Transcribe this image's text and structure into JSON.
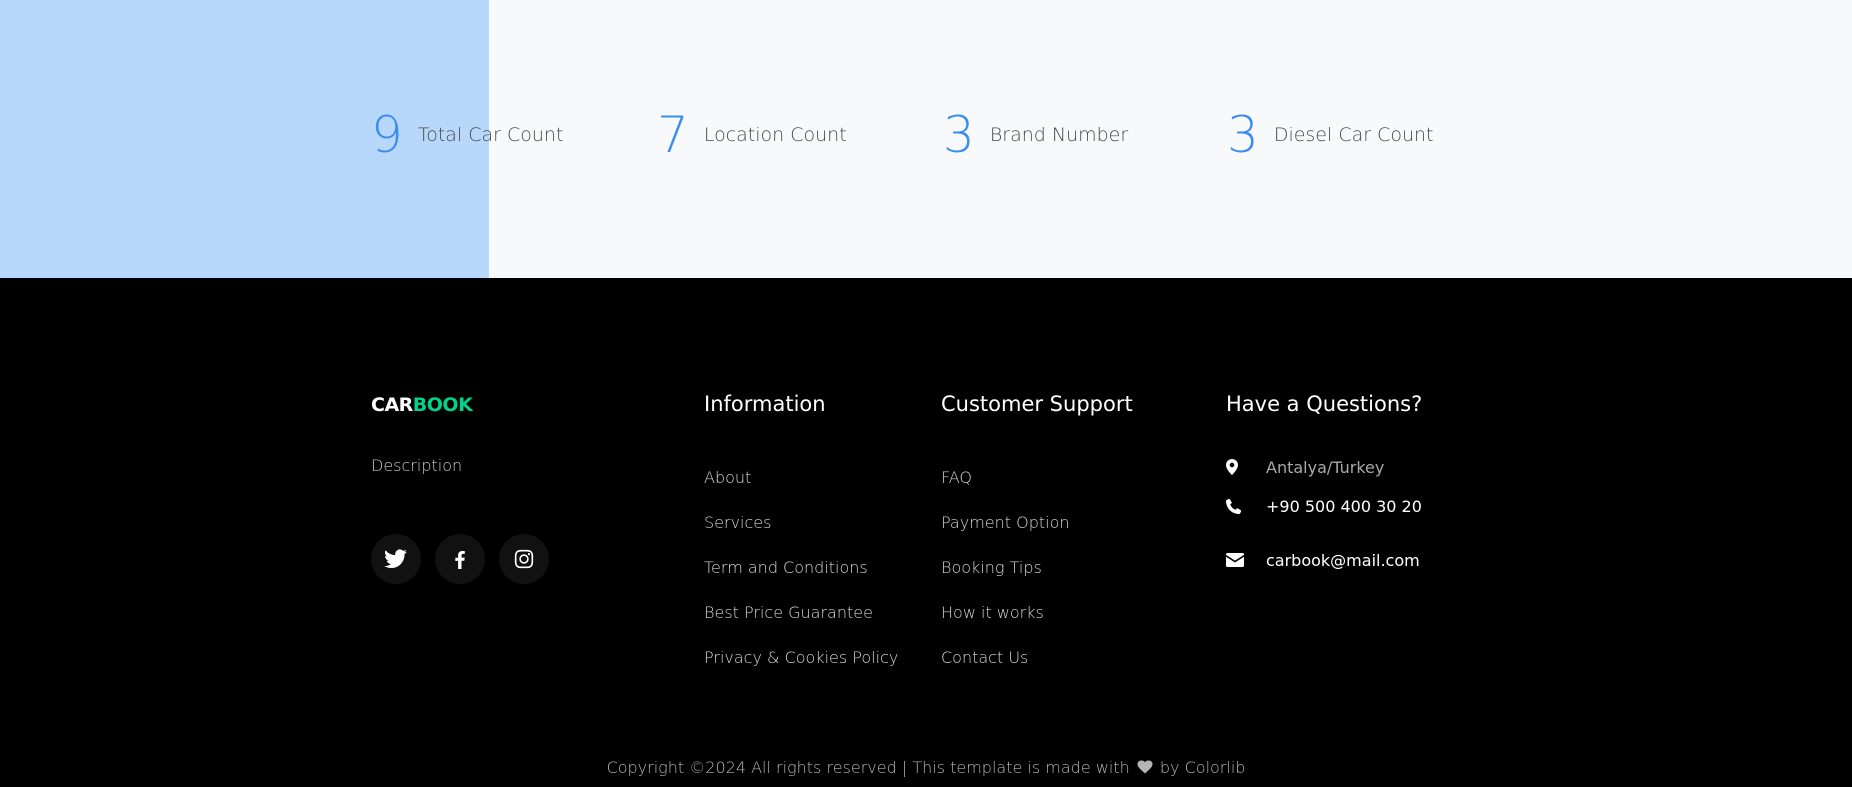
{
  "colors": {
    "accent": "#3a8df0",
    "counter_label": "#4a4a4a",
    "brand_green": "#01d28e",
    "footer_bg": "#000000",
    "counter_bg": "#f8f9fa",
    "counter_accent_panel": "#b8d8fb"
  },
  "counters": [
    {
      "number": "9",
      "label": "Total Car Count"
    },
    {
      "number": "7",
      "label": "Location Count"
    },
    {
      "number": "3",
      "label": "Brand Number"
    },
    {
      "number": "3",
      "label": "Diesel Car Count"
    }
  ],
  "footer": {
    "logo": {
      "part1": "CAR",
      "part2": "BOOK"
    },
    "description": "Description",
    "socials": [
      {
        "icon": "twitter-icon"
      },
      {
        "icon": "facebook-icon"
      },
      {
        "icon": "instagram-icon"
      }
    ],
    "information": {
      "title": "Information",
      "links": [
        "About",
        "Services",
        "Term and Conditions",
        "Best Price Guarantee",
        "Privacy & Cookies Policy"
      ]
    },
    "support": {
      "title": "Customer Support",
      "links": [
        "FAQ",
        "Payment Option",
        "Booking Tips",
        "How it works",
        "Contact Us"
      ]
    },
    "contact": {
      "title": "Have a Questions?",
      "address": "Antalya/Turkey",
      "phone": "+90 500 400 30 20",
      "email": "carbook@mail.com"
    },
    "copyright": {
      "prefix": "Copyright ©2024 All rights reserved | This template is made with",
      "heart_icon": "heart-icon",
      "suffix": "by Colorlib"
    }
  }
}
